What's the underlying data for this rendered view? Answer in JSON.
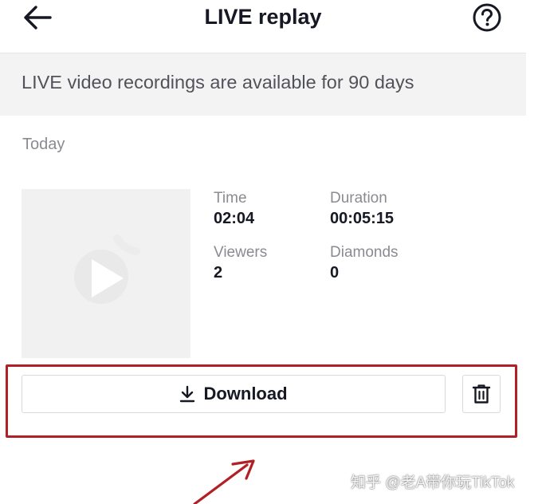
{
  "header": {
    "title": "LIVE replay",
    "back_icon": "arrow-left-icon",
    "help_icon": "question-circle-icon"
  },
  "banner": {
    "text": "LIVE video recordings are available for 90 days"
  },
  "section": {
    "date_label": "Today"
  },
  "replay": {
    "thumbnail_icon": "play-icon",
    "stats": {
      "time_label": "Time",
      "time_value": "02:04",
      "duration_label": "Duration",
      "duration_value": "00:05:15",
      "viewers_label": "Viewers",
      "viewers_value": "2",
      "diamonds_label": "Diamonds",
      "diamonds_value": "0"
    }
  },
  "actions": {
    "download_label": "Download",
    "download_icon": "download-icon",
    "delete_icon": "trash-icon"
  },
  "annotation": {
    "color": "#b21f24"
  },
  "watermark": {
    "text": "知乎 @老A带你玩TikTok"
  }
}
